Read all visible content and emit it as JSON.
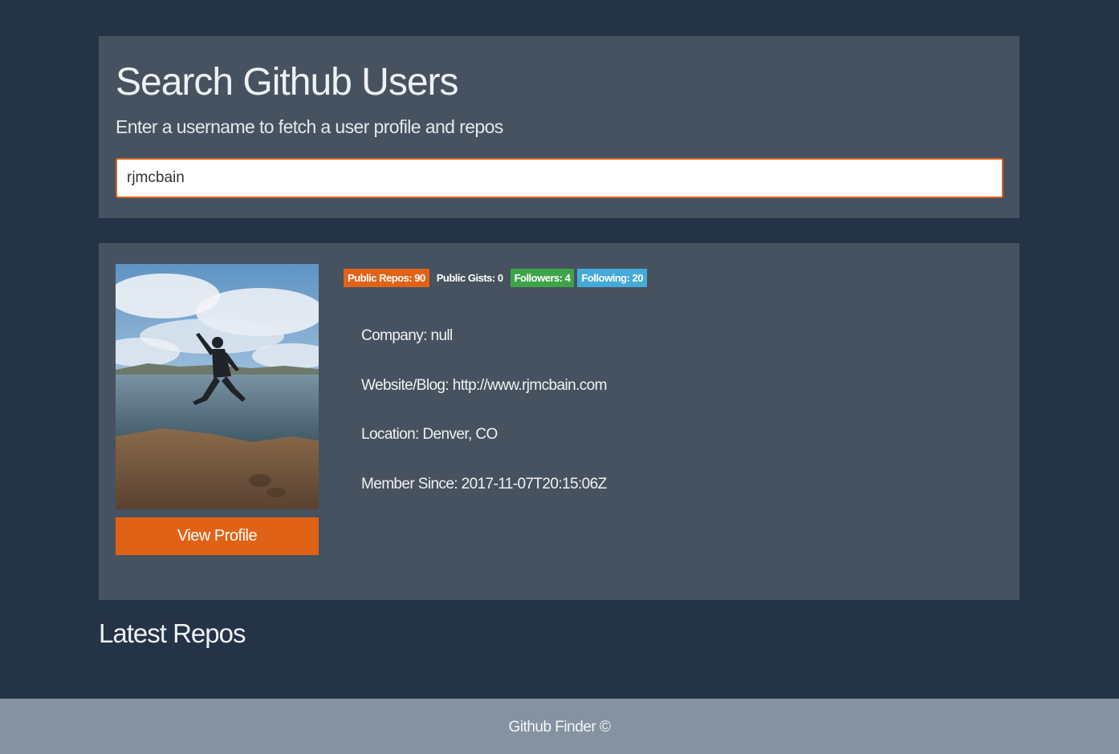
{
  "search": {
    "title": "Search Github Users",
    "subtitle": "Enter a username to fetch a user profile and repos",
    "input_value": "rjmcbain"
  },
  "profile": {
    "view_profile_label": "View Profile",
    "badges": {
      "public_repos": "Public Repos: 90",
      "public_gists": "Public Gists: 0",
      "followers": "Followers: 4",
      "following": "Following: 20"
    },
    "info": {
      "company": "Company: null",
      "website": "Website/Blog: http://www.rjmcbain.com",
      "location": "Location: Denver, CO",
      "member_since": "Member Since: 2017-11-07T20:15:06Z"
    }
  },
  "repos": {
    "title": "Latest Repos"
  },
  "footer": {
    "text": "Github Finder ©"
  },
  "colors": {
    "background": "#253346",
    "panel": "#46525f",
    "accent_orange": "#e06217",
    "badge_green": "#3ea44a",
    "badge_blue": "#45a9d9",
    "footer": "#8492a1"
  }
}
